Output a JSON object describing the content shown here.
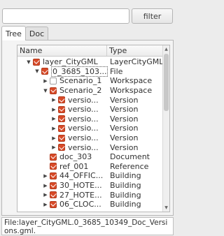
{
  "filter": {
    "value": "",
    "button_label": "filter"
  },
  "tabs": [
    {
      "label": "Tree",
      "active": true
    },
    {
      "label": "Doc",
      "active": false
    }
  ],
  "tree": {
    "columns": [
      "Name",
      "Type"
    ],
    "rows": [
      {
        "name": "layer_CityGML",
        "type": "LayerCityGML"
      },
      {
        "name": "0_3685_103...",
        "type": "File"
      },
      {
        "name": "Scenario_1",
        "type": "Workspace"
      },
      {
        "name": "Scenario_2",
        "type": "Workspace"
      },
      {
        "name": "versio...",
        "type": "Version"
      },
      {
        "name": "versio...",
        "type": "Version"
      },
      {
        "name": "versio...",
        "type": "Version"
      },
      {
        "name": "versio...",
        "type": "Version"
      },
      {
        "name": "versio...",
        "type": "Version"
      },
      {
        "name": "versio...",
        "type": "Version"
      },
      {
        "name": "doc_303",
        "type": "Document"
      },
      {
        "name": "ref_001",
        "type": "Reference"
      },
      {
        "name": "44_OFFIC...",
        "type": "Building"
      },
      {
        "name": "30_HOTE...",
        "type": "Building"
      },
      {
        "name": "27_HOTE...",
        "type": "Building"
      },
      {
        "name": "06_CLOC...",
        "type": "Building"
      }
    ]
  },
  "status_text": "File:layer_CityGML.0_3685_10349_Doc_Versions.gml."
}
